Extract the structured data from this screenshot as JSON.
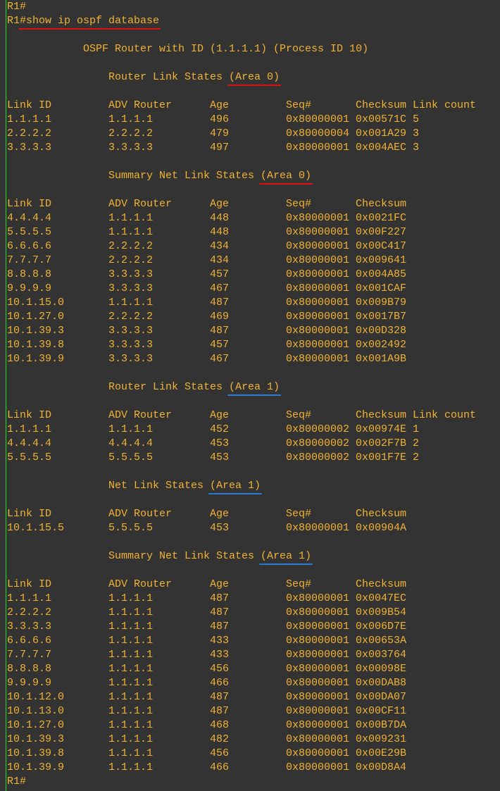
{
  "terminal": {
    "prompt": "R1#",
    "command_line": "R1#show ip ospf database",
    "router_header": "OSPF Router with ID (1.1.1.1) (Process ID 10)",
    "final_prompt": "R1#",
    "colors": {
      "text": "#f2b233",
      "background": "#333333",
      "area0_underline": "#e01010",
      "area1_underline": "#2a7bd0"
    }
  },
  "sections": [
    {
      "title": "Router Link States ",
      "area": "(Area 0)",
      "mark": "red",
      "columns": [
        "Link ID",
        "ADV Router",
        "Age",
        "Seq#",
        "Checksum",
        "Link count"
      ],
      "rows": [
        [
          "1.1.1.1",
          "1.1.1.1",
          "496",
          "0x80000001",
          "0x00571C",
          "5"
        ],
        [
          "2.2.2.2",
          "2.2.2.2",
          "479",
          "0x80000004",
          "0x001A29",
          "3"
        ],
        [
          "3.3.3.3",
          "3.3.3.3",
          "497",
          "0x80000001",
          "0x004AEC",
          "3"
        ]
      ]
    },
    {
      "title": "Summary Net Link States ",
      "area": "(Area 0)",
      "mark": "red",
      "columns": [
        "Link ID",
        "ADV Router",
        "Age",
        "Seq#",
        "Checksum"
      ],
      "rows": [
        [
          "4.4.4.4",
          "1.1.1.1",
          "448",
          "0x80000001",
          "0x0021FC"
        ],
        [
          "5.5.5.5",
          "1.1.1.1",
          "448",
          "0x80000001",
          "0x00F227"
        ],
        [
          "6.6.6.6",
          "2.2.2.2",
          "434",
          "0x80000001",
          "0x00C417"
        ],
        [
          "7.7.7.7",
          "2.2.2.2",
          "434",
          "0x80000001",
          "0x009641"
        ],
        [
          "8.8.8.8",
          "3.3.3.3",
          "457",
          "0x80000001",
          "0x004A85"
        ],
        [
          "9.9.9.9",
          "3.3.3.3",
          "467",
          "0x80000001",
          "0x001CAF"
        ],
        [
          "10.1.15.0",
          "1.1.1.1",
          "487",
          "0x80000001",
          "0x009B79"
        ],
        [
          "10.1.27.0",
          "2.2.2.2",
          "469",
          "0x80000001",
          "0x0017B7"
        ],
        [
          "10.1.39.3",
          "3.3.3.3",
          "487",
          "0x80000001",
          "0x00D328"
        ],
        [
          "10.1.39.8",
          "3.3.3.3",
          "457",
          "0x80000001",
          "0x002492"
        ],
        [
          "10.1.39.9",
          "3.3.3.3",
          "467",
          "0x80000001",
          "0x001A9B"
        ]
      ]
    },
    {
      "title": "Router Link States ",
      "area": "(Area 1)",
      "mark": "blue",
      "columns": [
        "Link ID",
        "ADV Router",
        "Age",
        "Seq#",
        "Checksum",
        "Link count"
      ],
      "rows": [
        [
          "1.1.1.1",
          "1.1.1.1",
          "452",
          "0x80000002",
          "0x00974E",
          "1"
        ],
        [
          "4.4.4.4",
          "4.4.4.4",
          "453",
          "0x80000002",
          "0x002F7B",
          "2"
        ],
        [
          "5.5.5.5",
          "5.5.5.5",
          "453",
          "0x80000002",
          "0x001F7E",
          "2"
        ]
      ]
    },
    {
      "title": "Net Link States ",
      "area": "(Area 1)",
      "mark": "blue",
      "columns": [
        "Link ID",
        "ADV Router",
        "Age",
        "Seq#",
        "Checksum"
      ],
      "rows": [
        [
          "10.1.15.5",
          "5.5.5.5",
          "453",
          "0x80000001",
          "0x00904A"
        ]
      ]
    },
    {
      "title": "Summary Net Link States ",
      "area": "(Area 1)",
      "mark": "blue",
      "columns": [
        "Link ID",
        "ADV Router",
        "Age",
        "Seq#",
        "Checksum"
      ],
      "rows": [
        [
          "1.1.1.1",
          "1.1.1.1",
          "487",
          "0x80000001",
          "0x0047EC"
        ],
        [
          "2.2.2.2",
          "1.1.1.1",
          "487",
          "0x80000001",
          "0x009B54"
        ],
        [
          "3.3.3.3",
          "1.1.1.1",
          "487",
          "0x80000001",
          "0x006D7E"
        ],
        [
          "6.6.6.6",
          "1.1.1.1",
          "433",
          "0x80000001",
          "0x00653A"
        ],
        [
          "7.7.7.7",
          "1.1.1.1",
          "433",
          "0x80000001",
          "0x003764"
        ],
        [
          "8.8.8.8",
          "1.1.1.1",
          "456",
          "0x80000001",
          "0x00098E"
        ],
        [
          "9.9.9.9",
          "1.1.1.1",
          "466",
          "0x80000001",
          "0x00DAB8"
        ],
        [
          "10.1.12.0",
          "1.1.1.1",
          "487",
          "0x80000001",
          "0x00DA07"
        ],
        [
          "10.1.13.0",
          "1.1.1.1",
          "487",
          "0x80000001",
          "0x00CF11"
        ],
        [
          "10.1.27.0",
          "1.1.1.1",
          "468",
          "0x80000001",
          "0x00B7DA"
        ],
        [
          "10.1.39.3",
          "1.1.1.1",
          "482",
          "0x80000001",
          "0x009231"
        ],
        [
          "10.1.39.8",
          "1.1.1.1",
          "456",
          "0x80000001",
          "0x00E29B"
        ],
        [
          "10.1.39.9",
          "1.1.1.1",
          "466",
          "0x80000001",
          "0x00D8A4"
        ]
      ]
    }
  ]
}
